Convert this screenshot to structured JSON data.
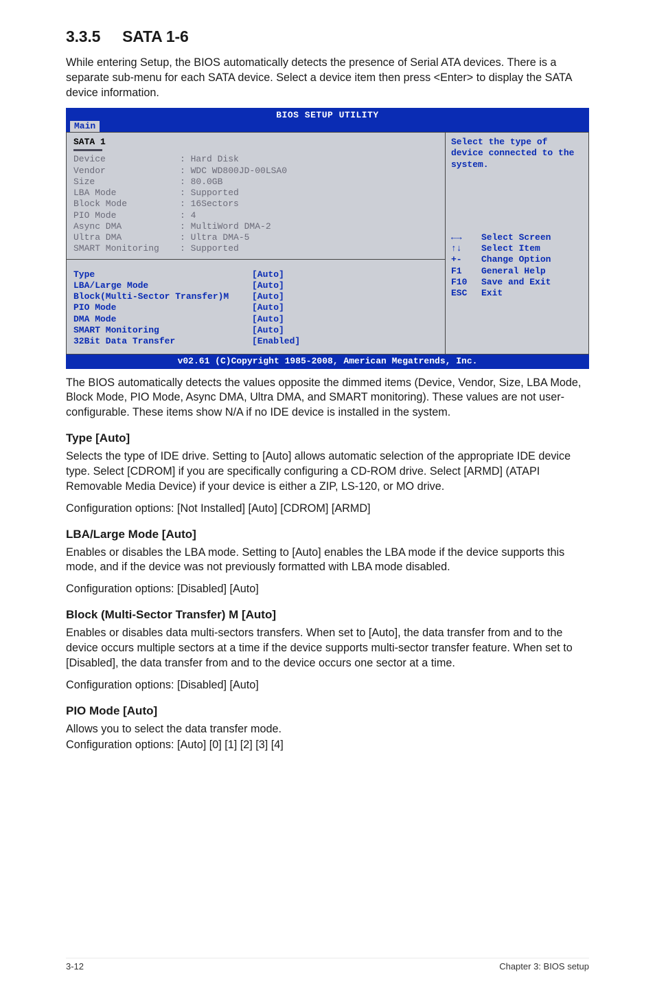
{
  "section": {
    "number": "3.3.5",
    "title": "SATA 1-6"
  },
  "intro": "While entering Setup, the BIOS automatically detects the presence of Serial ATA devices. There is a separate sub-menu for each SATA device. Select a device item then press <Enter> to display the SATA device information.",
  "bios": {
    "title": "BIOS SETUP UTILITY",
    "tab": "Main",
    "panel_title": "SATA 1",
    "help_text": "Select the type of device connected to the system.",
    "info": [
      {
        "label": "Device",
        "value": ": Hard Disk"
      },
      {
        "label": "Vendor",
        "value": ": WDC WD800JD-00LSA0"
      },
      {
        "label": "Size",
        "value": ": 80.0GB"
      },
      {
        "label": "LBA Mode",
        "value": ": Supported"
      },
      {
        "label": "Block Mode",
        "value": ": 16Sectors"
      },
      {
        "label": "PIO Mode",
        "value": ": 4"
      },
      {
        "label": "Async DMA",
        "value": ": MultiWord DMA-2"
      },
      {
        "label": "Ultra DMA",
        "value": ": Ultra DMA-5"
      },
      {
        "label": "SMART Monitoring",
        "value": ": Supported"
      }
    ],
    "active": [
      {
        "label": "Type",
        "value": "[Auto]"
      },
      {
        "label": "LBA/Large Mode",
        "value": "[Auto]"
      },
      {
        "label": "Block(Multi-Sector Transfer)M",
        "value": "[Auto]"
      },
      {
        "label": "PIO Mode",
        "value": "[Auto]"
      },
      {
        "label": "DMA Mode",
        "value": "[Auto]"
      },
      {
        "label": "SMART Monitoring",
        "value": "[Auto]"
      },
      {
        "label": "32Bit Data Transfer",
        "value": "[Enabled]"
      }
    ],
    "hotkeys": [
      {
        "key_icon": "lr",
        "key": "",
        "desc": "Select Screen"
      },
      {
        "key_icon": "ud",
        "key": "",
        "desc": "Select Item"
      },
      {
        "key_icon": "",
        "key": "+-",
        "desc": "Change Option"
      },
      {
        "key_icon": "",
        "key": "F1",
        "desc": "General Help"
      },
      {
        "key_icon": "",
        "key": "F10",
        "desc": "Save and Exit"
      },
      {
        "key_icon": "",
        "key": "ESC",
        "desc": "Exit"
      }
    ],
    "footer": "v02.61 (C)Copyright 1985-2008, American Megatrends, Inc."
  },
  "post_bios": "The BIOS automatically detects the values opposite the dimmed items (Device, Vendor, Size, LBA Mode, Block Mode, PIO Mode, Async DMA, Ultra DMA, and SMART monitoring). These values are not user-configurable. These items show N/A if no IDE device is installed in the system.",
  "type_section": {
    "heading": "Type [Auto]",
    "body": "Selects the type of IDE drive. Setting to [Auto] allows automatic selection of the appropriate IDE device type. Select [CDROM] if you are specifically configuring a CD-ROM drive. Select [ARMD] (ATAPI Removable Media Device) if your device is either a ZIP, LS-120, or MO drive.",
    "config": "Configuration options: [Not Installed] [Auto] [CDROM] [ARMD]"
  },
  "lba_section": {
    "heading": "LBA/Large Mode [Auto]",
    "body": "Enables or disables the LBA mode. Setting to [Auto] enables the LBA mode if the device supports this mode, and if the device was not previously formatted with LBA mode disabled.",
    "config": "Configuration options: [Disabled] [Auto]"
  },
  "block_section": {
    "heading": "Block (Multi-Sector Transfer) M [Auto]",
    "body": "Enables or disables data multi-sectors transfers. When set to [Auto], the data transfer from and to the device occurs multiple sectors at a time if the device supports multi-sector transfer feature. When set to [Disabled], the data transfer from and to the device occurs one sector at a time.",
    "config": "Configuration options: [Disabled] [Auto]"
  },
  "pio_section": {
    "heading": "PIO Mode [Auto]",
    "body": "Allows you to select the data transfer mode.",
    "config": "Configuration options: [Auto] [0] [1] [2] [3] [4]"
  },
  "footer": {
    "left": "3-12",
    "right": "Chapter 3: BIOS setup"
  }
}
